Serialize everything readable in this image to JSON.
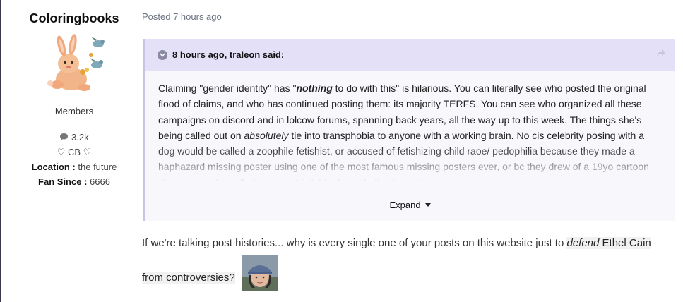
{
  "author": {
    "name": "Coloringbooks",
    "group": "Members",
    "posts_count": "3.2k",
    "tag": "♡ CB ♡",
    "location_label": "Location :",
    "location_value": "the future",
    "fan_since_label": "Fan Since :",
    "fan_since_value": "6666"
  },
  "post": {
    "posted": "Posted 7 hours ago"
  },
  "quote": {
    "header": "8 hours ago, traleon said:",
    "text_1": "Claiming \"gender identity\" has \"",
    "text_italic": "nothing",
    "text_2": " to do with this\" is hilarious. You can literally see who posted the original flood of claims, and who has continued posting them: its majority TERFS. You can see who organized all these campaigns on discord and in lolcow forums, spanning back years, all the way up to this week. The things she's being called out on ",
    "text_italic_2": "absolutely",
    "text_3": " tie into transphobia to anyone with a working brain. No cis celebrity posing with a dog would be called a zoophile fetishist, or accused of fetishizing child raoe/ pedophilia because they made a haphazard missing poster using one of the most famous missing posters ever, or bc they drew of a 19yo cartoon character, or be called an incest fetishist for including incest topics",
    "expand_label": "Expand"
  },
  "reply": {
    "part_1": "If we're talking post histories... why is every single one of your posts on this website just to ",
    "italic": "defend",
    "part_2": " Ethel Cain from controversies?"
  },
  "colors": {
    "quote_header_bg": "#e4e0f8",
    "quote_body_bg": "#f8f7fc",
    "meta_text": "#6b7280"
  }
}
